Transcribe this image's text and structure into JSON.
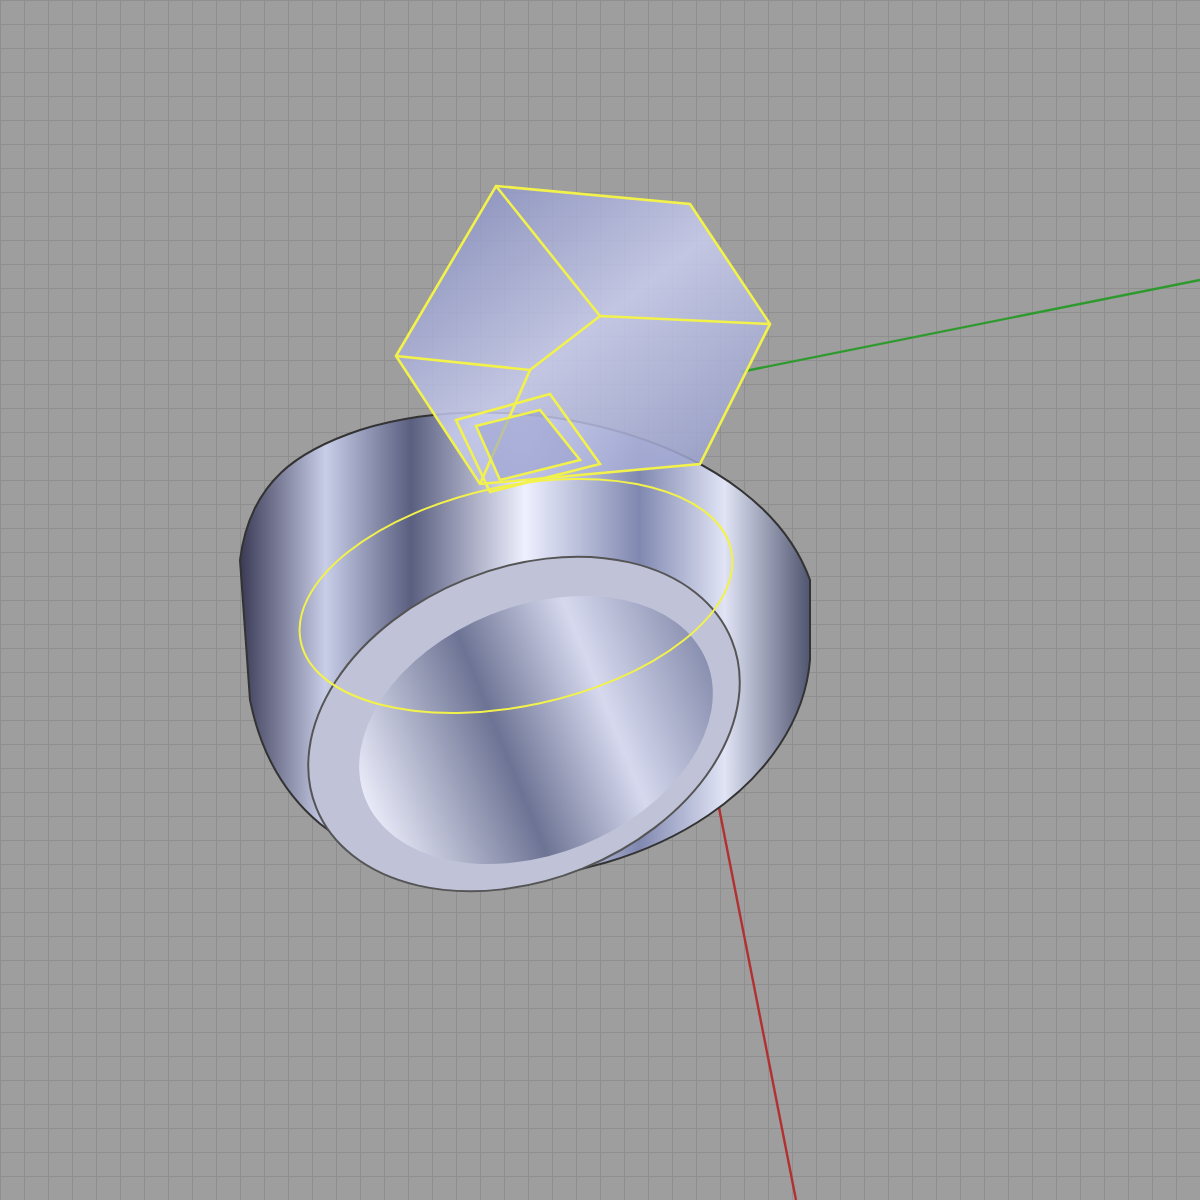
{
  "viewport": {
    "grid": true,
    "axes": true,
    "objects": [
      {
        "kind": "ring",
        "selected": false
      },
      {
        "kind": "gem",
        "selected": true
      }
    ]
  }
}
